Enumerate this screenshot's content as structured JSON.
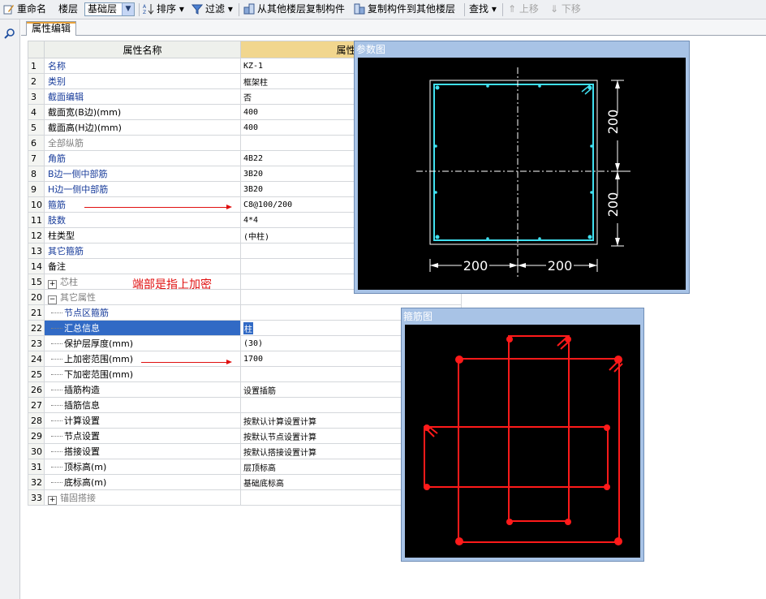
{
  "toolbar": {
    "rename": "重命名",
    "floor_label": "楼层",
    "floor_value": "基础层",
    "sort": "排序",
    "filter": "过滤",
    "copy_from": "从其他楼层复制构件",
    "copy_to": "复制构件到其他楼层",
    "find": "查找",
    "move_up": "上移",
    "move_down": "下移"
  },
  "tab": {
    "label": "属性编辑"
  },
  "grid": {
    "header_name": "属性名称",
    "header_value": "属性值",
    "rows": [
      {
        "num": "1",
        "name": "名称",
        "value": "KZ-1",
        "style": "blue"
      },
      {
        "num": "2",
        "name": "类别",
        "value": "框架柱",
        "style": "blue"
      },
      {
        "num": "3",
        "name": "截面编辑",
        "value": "否",
        "style": "blue"
      },
      {
        "num": "4",
        "name": "截面宽(B边)(mm)",
        "value": "400",
        "style": "black"
      },
      {
        "num": "5",
        "name": "截面高(H边)(mm)",
        "value": "400",
        "style": "black"
      },
      {
        "num": "6",
        "name": "全部纵筋",
        "value": "",
        "style": "grey"
      },
      {
        "num": "7",
        "name": "角筋",
        "value": "4B22",
        "style": "blue"
      },
      {
        "num": "8",
        "name": "B边一侧中部筋",
        "value": "3B20",
        "style": "blue"
      },
      {
        "num": "9",
        "name": "H边一侧中部筋",
        "value": "3B20",
        "style": "blue"
      },
      {
        "num": "10",
        "name": "箍筋",
        "value": "C8@100/200",
        "style": "blue"
      },
      {
        "num": "11",
        "name": "肢数",
        "value": "4*4",
        "style": "blue"
      },
      {
        "num": "12",
        "name": "柱类型",
        "value": "(中柱)",
        "style": "black"
      },
      {
        "num": "13",
        "name": "其它箍筋",
        "value": "",
        "style": "blue"
      },
      {
        "num": "14",
        "name": "备注",
        "value": "",
        "style": "black"
      },
      {
        "num": "15",
        "name": "芯柱",
        "value": "",
        "style": "grey",
        "expander": "+"
      },
      {
        "num": "20",
        "name": "其它属性",
        "value": "",
        "style": "grey",
        "expander": "−"
      },
      {
        "num": "21",
        "name": "节点区箍筋",
        "value": "",
        "style": "blue",
        "tree": true
      },
      {
        "num": "22",
        "name": "汇总信息",
        "value": "柱",
        "style": "black",
        "tree": true,
        "selected": true
      },
      {
        "num": "23",
        "name": "保护层厚度(mm)",
        "value": "(30)",
        "style": "black",
        "tree": true
      },
      {
        "num": "24",
        "name": "上加密范围(mm)",
        "value": "1700",
        "style": "black",
        "tree": true
      },
      {
        "num": "25",
        "name": "下加密范围(mm)",
        "value": "",
        "style": "black",
        "tree": true
      },
      {
        "num": "26",
        "name": "插筋构造",
        "value": "设置插筋",
        "style": "black",
        "tree": true
      },
      {
        "num": "27",
        "name": "插筋信息",
        "value": "",
        "style": "black",
        "tree": true
      },
      {
        "num": "28",
        "name": "计算设置",
        "value": "按默认计算设置计算",
        "style": "black",
        "tree": true
      },
      {
        "num": "29",
        "name": "节点设置",
        "value": "按默认节点设置计算",
        "style": "black",
        "tree": true
      },
      {
        "num": "30",
        "name": "搭接设置",
        "value": "按默认搭接设置计算",
        "style": "black",
        "tree": true
      },
      {
        "num": "31",
        "name": "顶标高(m)",
        "value": "层顶标高",
        "style": "black",
        "tree": true
      },
      {
        "num": "32",
        "name": "底标高(m)",
        "value": "基础底标高",
        "style": "black",
        "tree": true
      },
      {
        "num": "33",
        "name": "锚固搭接",
        "value": "",
        "style": "grey",
        "expander": "+"
      }
    ]
  },
  "annotation": "端部是指上加密",
  "param_panel": {
    "title": "参数图",
    "dim_labels": [
      "200",
      "200",
      "200",
      "200"
    ]
  },
  "stirrup_panel": {
    "title": "箍筋图"
  },
  "colors": {
    "section_line": "#40e0f0",
    "stirrup_line": "#ff1a1a",
    "label_blue": "#173b9a",
    "annotation_red": "#e01010"
  }
}
